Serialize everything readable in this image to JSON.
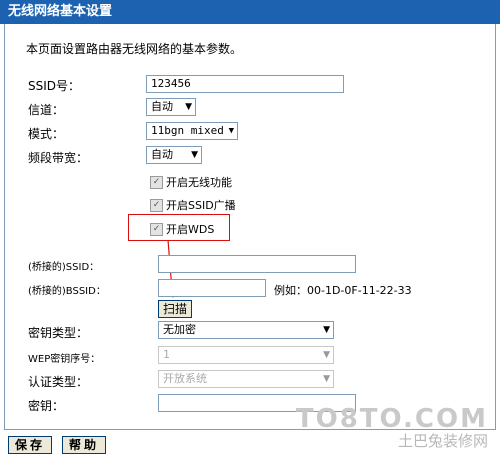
{
  "title": "无线网络基本设置",
  "intro": "本页面设置路由器无线网络的基本参数。",
  "ssid": {
    "label": "SSID号：",
    "value": "123456"
  },
  "channel": {
    "label": "信道：",
    "value": "自动"
  },
  "mode": {
    "label": "模式：",
    "value": "11bgn mixed"
  },
  "bandwidth": {
    "label": "频段带宽：",
    "value": "自动"
  },
  "checkboxes": {
    "wireless": "开启无线功能",
    "ssid_broadcast": "开启SSID广播",
    "wds": "开启WDS"
  },
  "bridge_ssid": {
    "label": "(桥接的)SSID：",
    "value": ""
  },
  "bridge_bssid": {
    "label": "(桥接的)BSSID：",
    "value": "",
    "example": "例如：00-1D-0F-11-22-33"
  },
  "scan_label": "扫描",
  "key_type": {
    "label": "密钥类型：",
    "value": "无加密"
  },
  "wep_index": {
    "label": "WEP密钥序号：",
    "value": "1"
  },
  "auth_type": {
    "label": "认证类型：",
    "value": "开放系统"
  },
  "key": {
    "label": "密钥：",
    "value": ""
  },
  "save_label": "保存",
  "help_label": "帮助",
  "watermark": {
    "big": "TO8TO.COM",
    "small": "土巴兔装修网"
  },
  "colors": {
    "title_bg": "#1c62b0",
    "highlight": "#d90f0f"
  }
}
